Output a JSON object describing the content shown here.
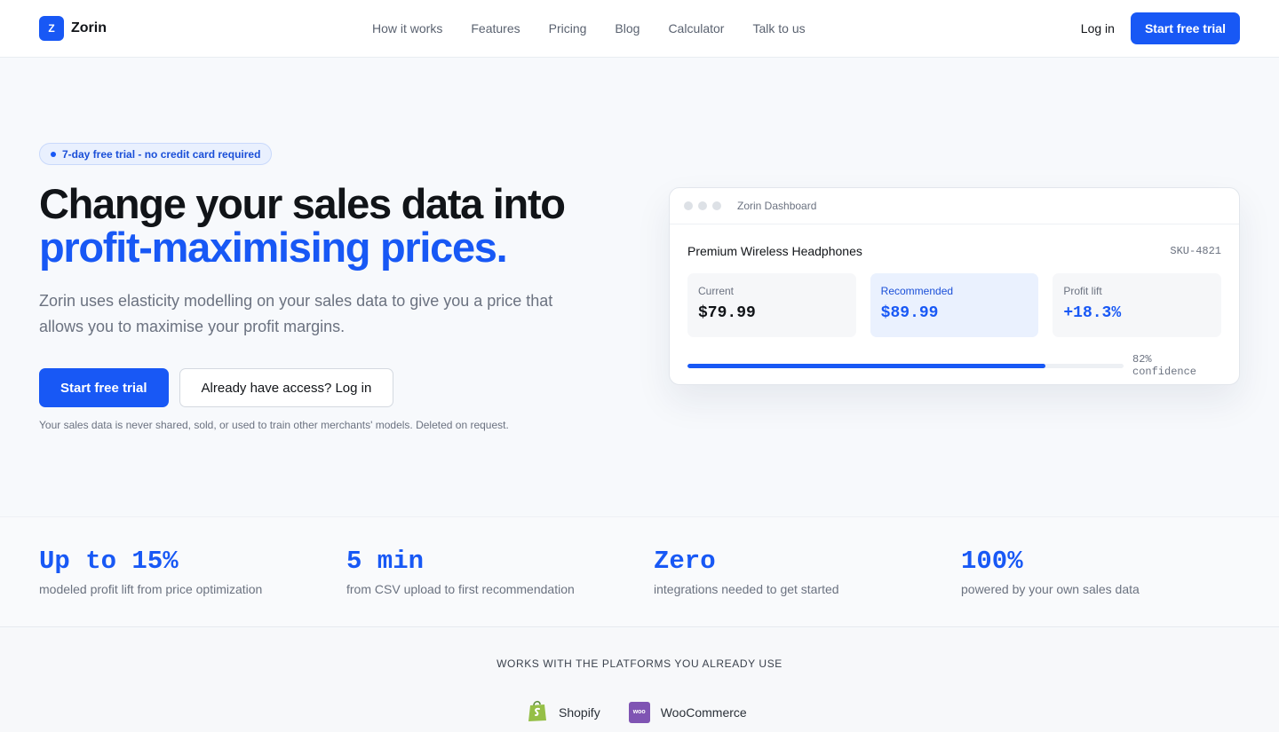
{
  "nav": {
    "brand_mark": "Z",
    "brand_name": "Zorin",
    "links": [
      "How it works",
      "Features",
      "Pricing",
      "Blog",
      "Calculator",
      "Talk to us"
    ],
    "login": "Log in",
    "cta": "Start free trial"
  },
  "hero": {
    "pill": "7-day free trial - no credit card required",
    "headline_1": "Change your sales data into",
    "headline_2": "profit-maximising prices.",
    "subhead": "Zorin uses elasticity modelling on your sales data to give you a price that allows you to maximise your profit margins.",
    "primary_button": "Start free trial",
    "secondary_button": "Already have access? Log in",
    "fineprint": "Your sales data is never shared, sold, or used to train other merchants' models. Deleted on request."
  },
  "dashboard": {
    "window_title": "Zorin Dashboard",
    "product": "Premium Wireless Headphones",
    "sku": "SKU-4821",
    "metrics": [
      {
        "label": "Current",
        "value": "$79.99"
      },
      {
        "label": "Recommended",
        "value": "$89.99"
      },
      {
        "label": "Profit lift",
        "value": "+18.3%"
      }
    ],
    "confidence_fraction": 0.82,
    "confidence_text": "82% confidence"
  },
  "stats": [
    {
      "value": "Up to 15%",
      "desc": "modeled profit lift from price optimization"
    },
    {
      "value": "5 min",
      "desc": "from CSV upload to first recommendation"
    },
    {
      "value": "Zero",
      "desc": "integrations needed to get started"
    },
    {
      "value": "100%",
      "desc": "powered by your own sales data"
    }
  ],
  "platforms": {
    "title": "WORKS WITH THE PLATFORMS YOU ALREADY USE",
    "items": [
      {
        "name": "Shopify",
        "icon": "shopify-bag-icon"
      },
      {
        "name": "WooCommerce",
        "icon": "woo-icon",
        "icon_text": "woo"
      }
    ]
  },
  "colors": {
    "accent": "#1858f5",
    "shopify_green": "#95bf47",
    "woo_purple": "#7f54b3"
  }
}
